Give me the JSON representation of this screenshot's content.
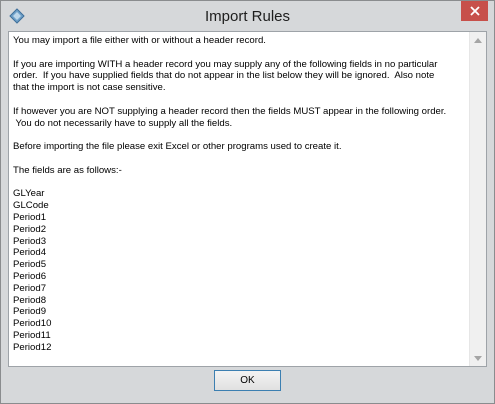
{
  "window": {
    "title": "Import Rules",
    "app_icon": "app-diamond-icon",
    "close_icon": "close-icon"
  },
  "content": {
    "lines": [
      "You may import a file either with or without a header record.",
      "",
      "If you are importing WITH a header record you may supply any of the following fields in no particular",
      "order.  If you have supplied fields that do not appear in the list below they will be ignored.  Also note",
      "that the import is not case sensitive.",
      "",
      "If however you are NOT supplying a header record then the fields MUST appear in the following order.",
      " You do not necessarily have to supply all the fields.",
      "",
      "Before importing the file please exit Excel or other programs used to create it.",
      "",
      "The fields are as follows:-",
      "",
      "GLYear",
      "GLCode",
      "Period1",
      "Period2",
      "Period3",
      "Period4",
      "Period5",
      "Period6",
      "Period7",
      "Period8",
      "Period9",
      "Period10",
      "Period11",
      "Period12"
    ]
  },
  "buttons": {
    "ok_label": "OK"
  },
  "colors": {
    "dialog_background": "#d6d8da",
    "close_button": "#c7504a",
    "ok_border": "#3c7fb1"
  }
}
